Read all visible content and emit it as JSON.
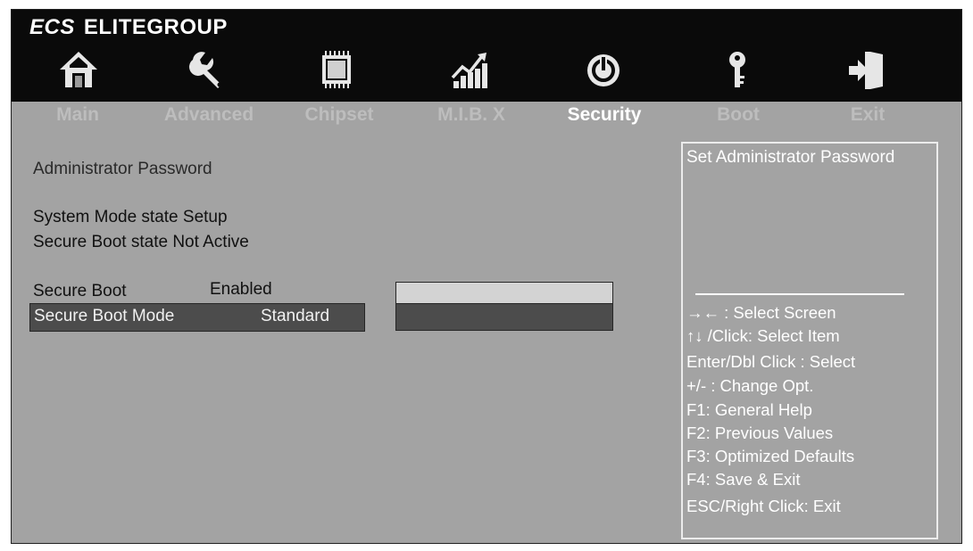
{
  "brand": {
    "logo_text": "ECS",
    "name": "ELITEGROUP"
  },
  "tabs": [
    {
      "label": "Main",
      "icon": "home-icon"
    },
    {
      "label": "Advanced",
      "icon": "wrench-icon"
    },
    {
      "label": "Chipset",
      "icon": "chip-icon"
    },
    {
      "label": "M.I.B. X",
      "icon": "performance-chart-icon"
    },
    {
      "label": "Security",
      "icon": "power-icon",
      "active": true
    },
    {
      "label": "Boot",
      "icon": "key-icon"
    },
    {
      "label": "Exit",
      "icon": "exit-icon"
    }
  ],
  "security": {
    "admin_password_label": "Administrator  Password",
    "system_mode_label": "System Mode state",
    "system_mode_value": "Setup",
    "secure_boot_state_label": "Secure Boot state",
    "secure_boot_state_value": "Not Active",
    "secure_boot_label": "Secure Boot",
    "secure_boot_value": "Enabled",
    "secure_boot_mode_label": "Secure Boot Mode",
    "secure_boot_mode_value": "Standard"
  },
  "help": {
    "title": "Set Administrator Password",
    "hints": [
      "→←  : Select Screen",
      "↑↓ /Click: Select Item",
      "Enter/Dbl Click : Select",
      "+/- : Change Opt.",
      "F1: General Help",
      "F2: Previous Values",
      "F3: Optimized Defaults",
      "F4: Save & Exit",
      "ESC/Right Click: Exit"
    ]
  },
  "colors": {
    "background": "#a3a3a3",
    "topbar": "#0a0a0a",
    "highlight_row": "#4c4c4c",
    "active_tab": "#ffffff",
    "inactive_tab": "#bdbdbd"
  }
}
